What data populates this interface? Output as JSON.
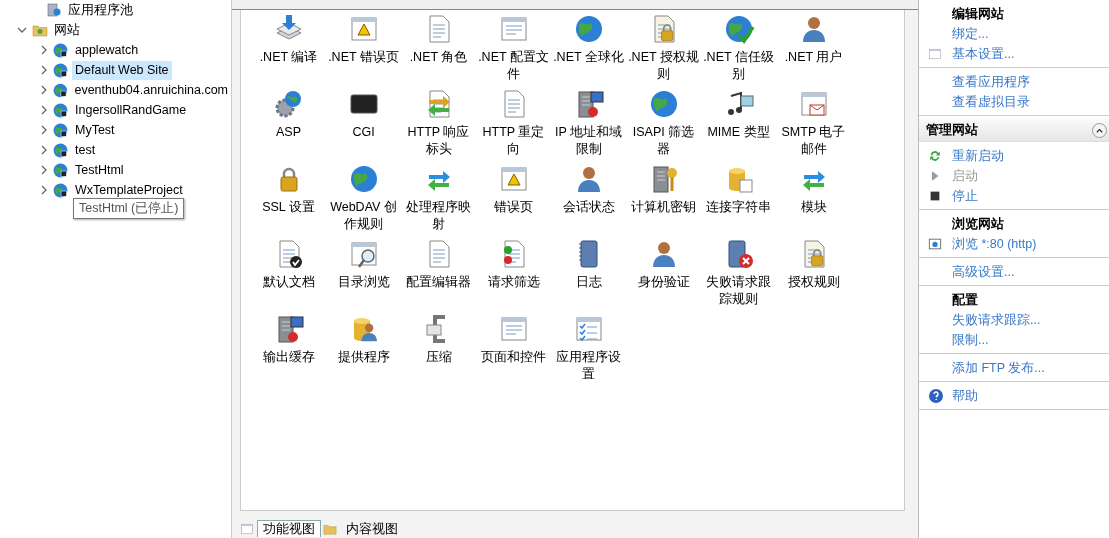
{
  "tree": {
    "items": [
      {
        "label": "应用程序池",
        "kind": "leaf"
      },
      {
        "label": "网站",
        "kind": "folder",
        "expanded": true,
        "children": [
          {
            "label": "applewatch",
            "expanded": false,
            "selected": false
          },
          {
            "label": "Default Web Site",
            "expanded": false,
            "selected": true
          },
          {
            "label": "eventhub04.anruichina.com",
            "expanded": false,
            "selected": false
          },
          {
            "label": "IngersollRandGame",
            "expanded": false,
            "selected": false
          },
          {
            "label": "MyTest",
            "expanded": false,
            "selected": false
          },
          {
            "label": "test",
            "expanded": false,
            "selected": false
          },
          {
            "label": "TestHtml",
            "expanded": false,
            "selected": false
          },
          {
            "label": "WxTemplateProject",
            "expanded": false,
            "selected": false
          }
        ]
      }
    ],
    "tooltip": "TestHtml (已停止)"
  },
  "features": [
    ".NET 编译",
    ".NET 错误页",
    ".NET 角色",
    ".NET 配置文件",
    ".NET 全球化",
    ".NET 授权规则",
    ".NET 信任级别",
    ".NET 用户",
    "ASP",
    "CGI",
    "HTTP 响应标头",
    "HTTP 重定向",
    "IP 地址和域限制",
    "ISAPI 筛选器",
    "MIME 类型",
    "SMTP 电子邮件",
    "SSL 设置",
    "WebDAV 创作规则",
    "处理程序映射",
    "错误页",
    "会话状态",
    "计算机密钥",
    "连接字符串",
    "模块",
    "默认文档",
    "目录浏览",
    "配置编辑器",
    "请求筛选",
    "日志",
    "身份验证",
    "失败请求跟踪规则",
    "授权规则",
    "输出缓存",
    "提供程序",
    "压缩",
    "页面和控件",
    "应用程序设置"
  ],
  "view_tabs": [
    {
      "label": "功能视图",
      "selected": true
    },
    {
      "label": "内容视图",
      "selected": false
    }
  ],
  "actions": {
    "groups": [
      {
        "sections": [
          {
            "title": "编辑网站",
            "items": [
              {
                "label": "绑定...",
                "disabled": false
              },
              {
                "label": "基本设置...",
                "kind": "settings",
                "disabled": false
              }
            ]
          },
          {
            "items": [
              {
                "label": "查看应用程序",
                "disabled": false
              },
              {
                "label": "查看虚拟目录",
                "disabled": false
              }
            ]
          }
        ]
      },
      {
        "header": "管理网站",
        "expanded": true,
        "sections": [
          {
            "items": [
              {
                "label": "重新启动",
                "kind": "restart",
                "disabled": false
              },
              {
                "label": "启动",
                "kind": "start",
                "disabled": true
              },
              {
                "label": "停止",
                "kind": "stop",
                "disabled": false
              }
            ]
          },
          {
            "title": "浏览网站",
            "items": [
              {
                "label": "浏览 *:80 (http)",
                "kind": "browse",
                "disabled": false
              }
            ]
          },
          {
            "items": [
              {
                "label": "高级设置...",
                "disabled": false
              }
            ]
          },
          {
            "title": "配置",
            "items": [
              {
                "label": "失败请求跟踪...",
                "disabled": false
              },
              {
                "label": "限制...",
                "disabled": false
              }
            ]
          },
          {
            "items": [
              {
                "label": "添加 FTP 发布...",
                "disabled": false
              }
            ]
          },
          {
            "items": [
              {
                "label": "帮助",
                "kind": "help",
                "disabled": false
              }
            ]
          }
        ]
      }
    ]
  }
}
